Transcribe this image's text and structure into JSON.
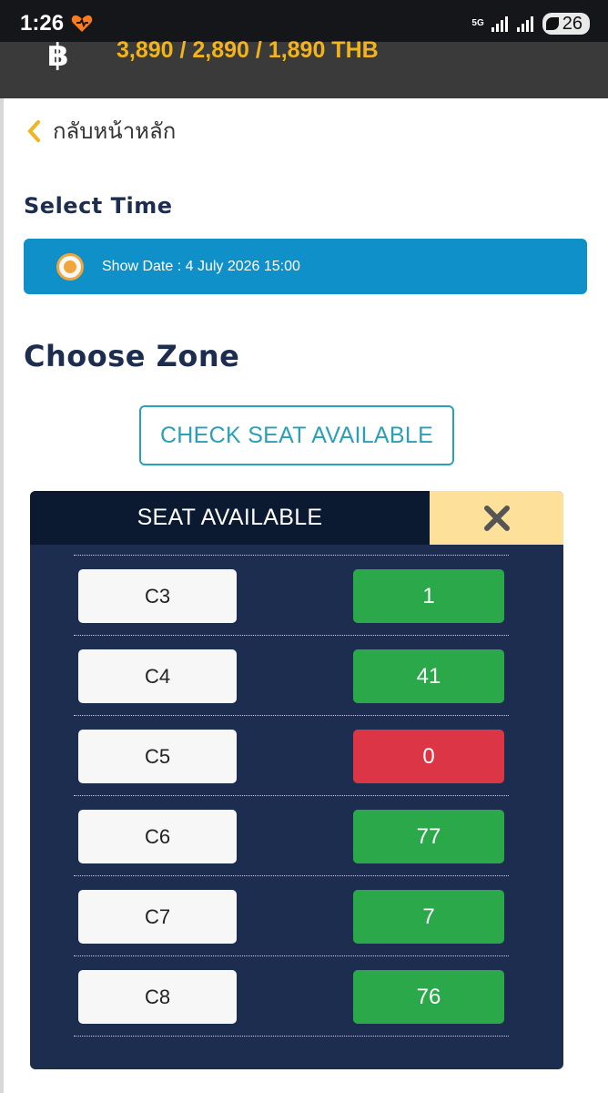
{
  "status_bar": {
    "time": "1:26",
    "network": "5G",
    "battery": "26"
  },
  "header": {
    "price_text": "3,890 / 2,890 / 1,890 THB",
    "currency_icon": "baht-icon"
  },
  "back": {
    "label": "กลับหน้าหลัก"
  },
  "select_time": {
    "heading": "Select Time",
    "show_date": "Show Date : 4 July 2026 15:00"
  },
  "choose_zone": {
    "heading": "Choose Zone",
    "check_button": "CHECK SEAT AVAILABLE"
  },
  "seat_panel": {
    "title": "SEAT AVAILABLE",
    "close_icon": "close-icon",
    "colors": {
      "available": "#2aa84a",
      "sold_out": "#dc3545"
    },
    "rows": [
      {
        "zone": "",
        "count": "",
        "status": "sold_out"
      },
      {
        "zone": "C3",
        "count": "1",
        "status": "available"
      },
      {
        "zone": "C4",
        "count": "41",
        "status": "available"
      },
      {
        "zone": "C5",
        "count": "0",
        "status": "sold_out"
      },
      {
        "zone": "C6",
        "count": "77",
        "status": "available"
      },
      {
        "zone": "C7",
        "count": "7",
        "status": "available"
      },
      {
        "zone": "C8",
        "count": "76",
        "status": "available"
      }
    ]
  }
}
